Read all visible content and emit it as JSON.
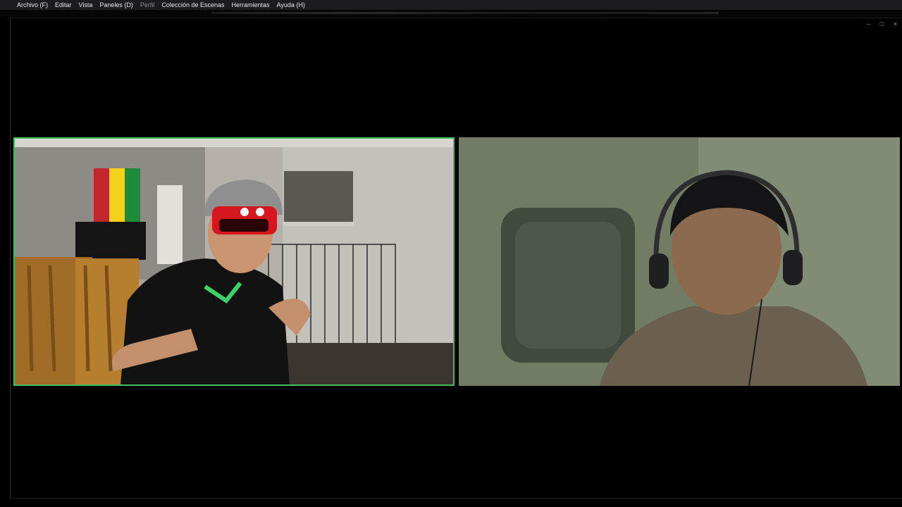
{
  "menubar": {
    "items": [
      {
        "label": "Archivo (F)",
        "enabled": true
      },
      {
        "label": "Editar",
        "enabled": true
      },
      {
        "label": "Vista",
        "enabled": true
      },
      {
        "label": "Paneles (D)",
        "enabled": true
      },
      {
        "label": "Perfil",
        "enabled": false
      },
      {
        "label": "Colección de Escenas",
        "enabled": true
      },
      {
        "label": "Herramientas",
        "enabled": true
      },
      {
        "label": "Ayuda (H)",
        "enabled": true
      }
    ]
  },
  "window": {
    "controls": {
      "minimize": "–",
      "maximize": "□",
      "close": "×"
    }
  },
  "video_tiles": {
    "left": {
      "active_speaker": true,
      "highlight_color": "#3fbf5f"
    },
    "right": {
      "active_speaker": false
    }
  }
}
